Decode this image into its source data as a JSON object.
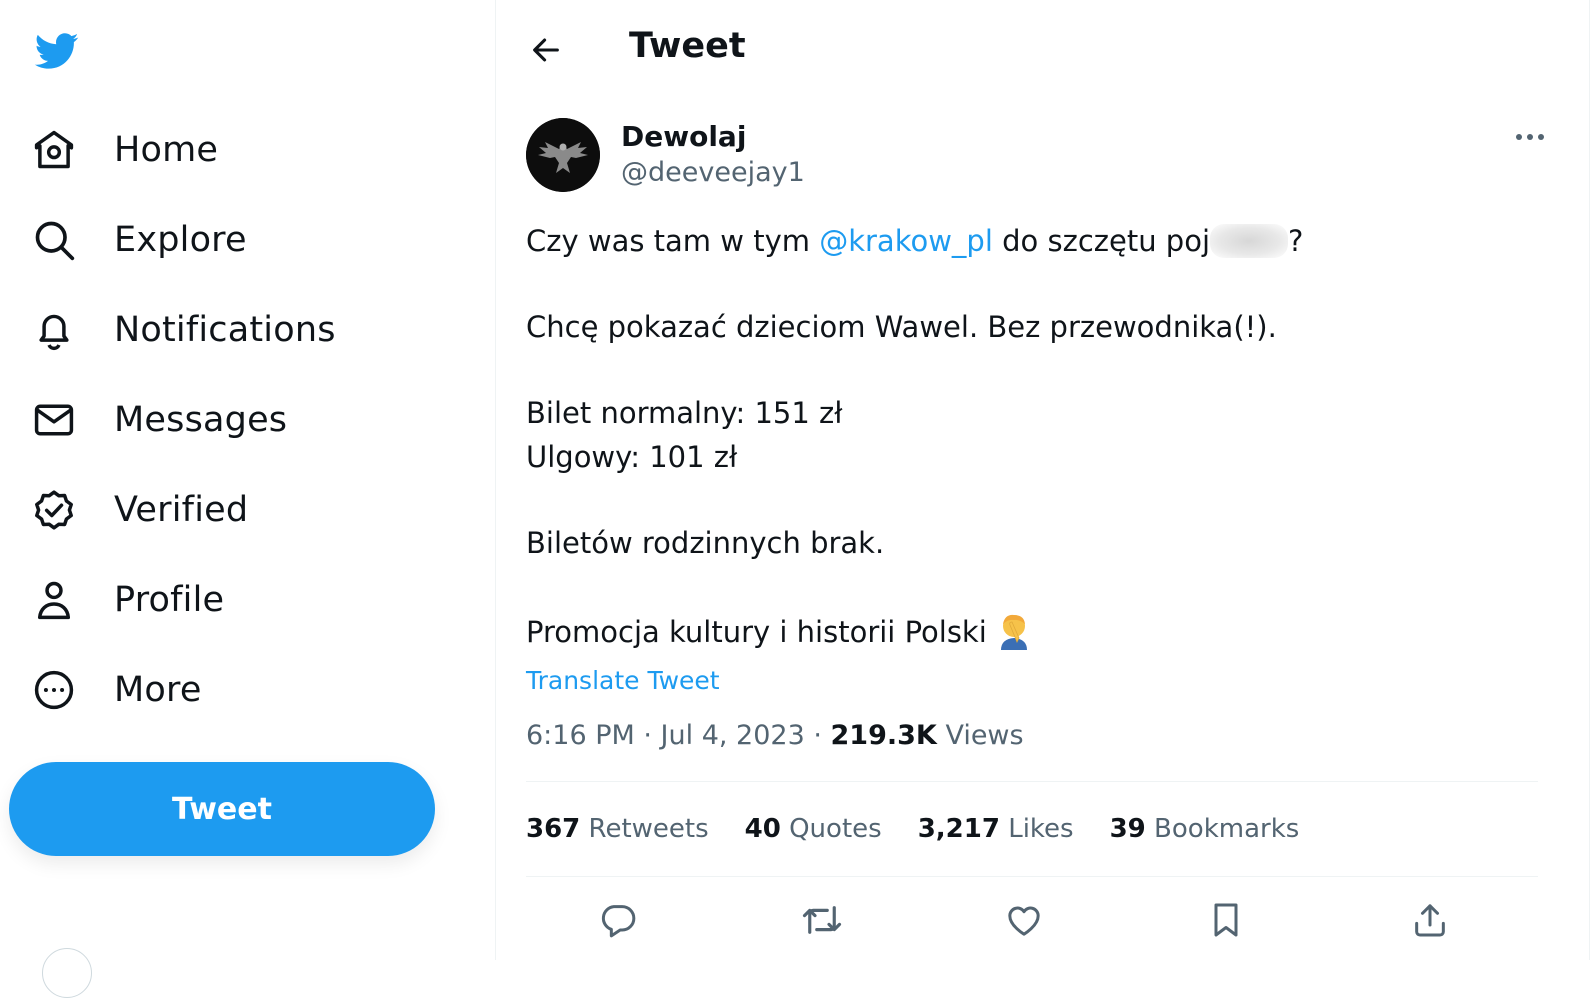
{
  "sidebar": {
    "logo_icon": "twitter-bird-icon",
    "items": [
      {
        "label": "Home",
        "icon": "home-icon"
      },
      {
        "label": "Explore",
        "icon": "search-icon"
      },
      {
        "label": "Notifications",
        "icon": "bell-icon"
      },
      {
        "label": "Messages",
        "icon": "envelope-icon"
      },
      {
        "label": "Verified",
        "icon": "verified-badge-icon"
      },
      {
        "label": "Profile",
        "icon": "person-icon"
      },
      {
        "label": "More",
        "icon": "more-circle-icon"
      }
    ],
    "tweet_button": "Tweet"
  },
  "header": {
    "back_icon": "arrow-left-icon",
    "title": "Tweet"
  },
  "tweet": {
    "author": {
      "name": "Dewolaj",
      "handle": "@deeveejay1",
      "avatar_icon": "eagle-emblem-avatar"
    },
    "more_icon": "more-horizontal-icon",
    "lines": {
      "l1_before": "Czy was tam w tym ",
      "mention": "@krakow_pl",
      "l1_after": " do szczętu poj",
      "l1_end": "?",
      "l2": "Chcę pokazać dzieciom Wawel. Bez przewodnika(!).",
      "l3": "Bilet normalny: 151 zł",
      "l4": "Ulgowy: 101 zł",
      "l5": "Biletów rodzinnych brak.",
      "l6": "Promocja kultury i historii Polski"
    },
    "emoji_icon": "facepalm-emoji",
    "translate": "Translate Tweet",
    "time": "6:16 PM",
    "date": "Jul 4, 2023",
    "separator": " · ",
    "views_count": "219.3K",
    "views_label": "Views"
  },
  "stats": {
    "retweets_count": "367",
    "retweets_label": "Retweets",
    "quotes_count": "40",
    "quotes_label": "Quotes",
    "likes_count": "3,217",
    "likes_label": "Likes",
    "bookmarks_count": "39",
    "bookmarks_label": "Bookmarks"
  },
  "actions": [
    "reply-icon",
    "retweet-icon",
    "like-icon",
    "bookmark-icon",
    "share-icon"
  ],
  "colors": {
    "accent": "#1d9bf0",
    "text": "#0f1419",
    "secondary": "#536471",
    "border": "#eff3f4"
  }
}
